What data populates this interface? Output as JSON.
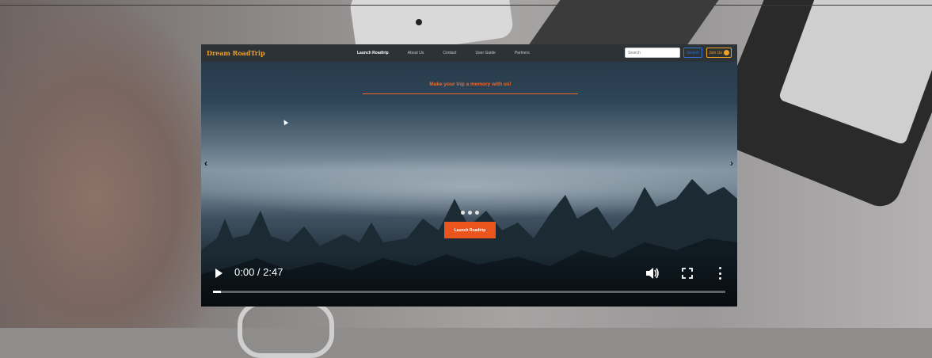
{
  "site": {
    "brand": "Dream RoadTrip"
  },
  "nav": {
    "links": [
      "Launch Roadtrip",
      "About Us",
      "Contact",
      "User Guide",
      "Partners"
    ],
    "active_index": 0
  },
  "search": {
    "placeholder": "Search",
    "button_label": "Search"
  },
  "join": {
    "label": "Join Us"
  },
  "hero": {
    "tagline": "Make your trip a memory with us!",
    "cta_label": "Launch Roadtrip",
    "prev_symbol": "‹",
    "next_symbol": "›",
    "carousel_dots": 3
  },
  "player": {
    "time_display": "0:00 / 2:47",
    "progress_fraction": 0.015,
    "icons": [
      "play-icon",
      "volume-icon",
      "fullscreen-icon",
      "more-options-icon"
    ]
  },
  "colors": {
    "brand": "#f0a028",
    "accent": "#e9551c",
    "navbar": "#2c3236"
  }
}
